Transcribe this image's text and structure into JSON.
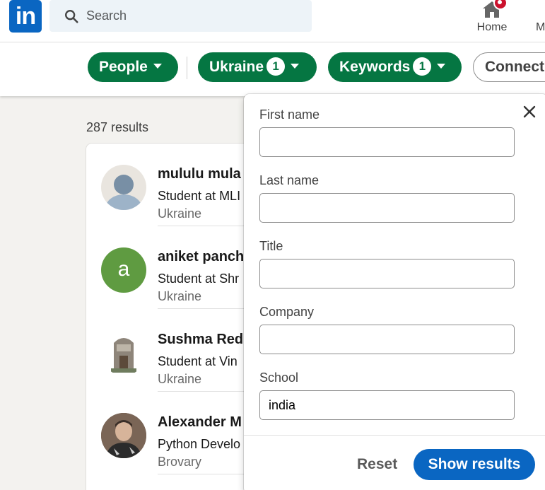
{
  "nav": {
    "logo_text": "in",
    "search_placeholder": "Search",
    "home_label": "Home",
    "me_label": "M"
  },
  "filters": {
    "people_label": "People",
    "location_label": "Ukraine",
    "location_count": "1",
    "keywords_label": "Keywords",
    "keywords_count": "1",
    "connections_label": "Connect"
  },
  "results": {
    "count_text": "287 results",
    "people": [
      {
        "name": "mululu mula",
        "headline": "Student at MLI",
        "location": "Ukraine",
        "avatar": "silhouette-icon"
      },
      {
        "name": "aniket panch",
        "headline": "Student at Shr",
        "location": "Ukraine",
        "avatar_letter": "a"
      },
      {
        "name": "Sushma Red",
        "headline": "Student at Vin",
        "location": "Ukraine",
        "avatar": "building-photo"
      },
      {
        "name": "Alexander M",
        "headline": "Python Develo",
        "location": "Brovary",
        "avatar": "person-photo"
      }
    ]
  },
  "keyword_panel": {
    "first_name_label": "First name",
    "first_name_value": "",
    "last_name_label": "Last name",
    "last_name_value": "",
    "title_label": "Title",
    "title_value": "",
    "company_label": "Company",
    "company_value": "",
    "school_label": "School",
    "school_value": "india",
    "reset_label": "Reset",
    "show_results_label": "Show results"
  },
  "colors": {
    "brand_blue": "#0a66c2",
    "filter_green": "#057642",
    "notification_red": "#cb112d"
  }
}
